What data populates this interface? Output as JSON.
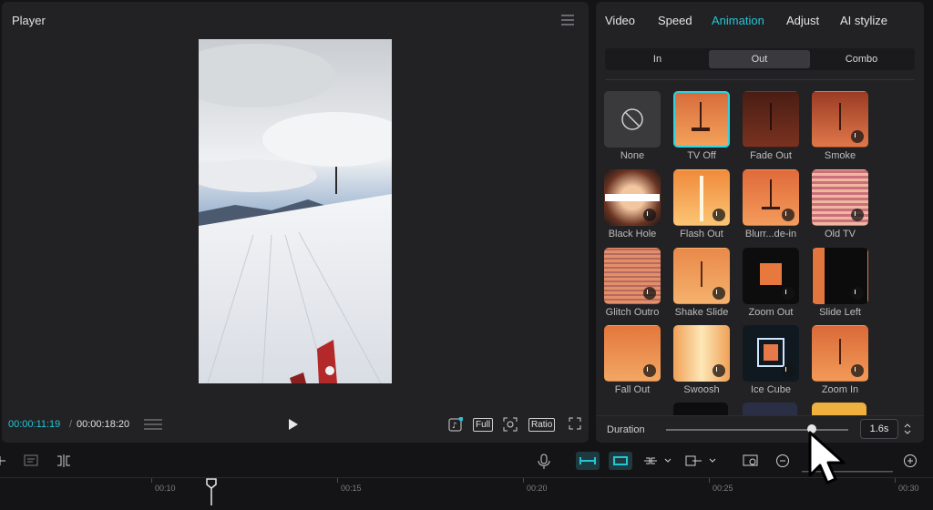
{
  "player": {
    "title": "Player",
    "current_time": "00:00:11:19",
    "separator": "/",
    "total_time": "00:00:18:20",
    "controls": {
      "full": "Full",
      "ratio": "Ratio"
    }
  },
  "right_panel": {
    "tabs": [
      "Video",
      "Speed",
      "Animation",
      "Adjust",
      "AI stylize"
    ],
    "active_tab": "Animation",
    "segments": [
      "In",
      "Out",
      "Combo"
    ],
    "active_segment": "Out",
    "items": [
      {
        "label": "None"
      },
      {
        "label": "TV Off"
      },
      {
        "label": "Fade Out"
      },
      {
        "label": "Smoke"
      },
      {
        "label": "Black Hole"
      },
      {
        "label": "Flash Out"
      },
      {
        "label": "Blurr...de-in"
      },
      {
        "label": "Old TV"
      },
      {
        "label": "Glitch Outro"
      },
      {
        "label": "Shake Slide"
      },
      {
        "label": "Zoom Out"
      },
      {
        "label": "Slide Left"
      },
      {
        "label": "Fall Out"
      },
      {
        "label": "Swoosh"
      },
      {
        "label": "Ice Cube"
      },
      {
        "label": "Zoom In"
      }
    ],
    "duration": {
      "label": "Duration",
      "value": "1.6s",
      "slider_fraction": 0.8
    }
  },
  "timeline": {
    "ruler_labels": [
      "00:10",
      "00:15",
      "00:20",
      "00:25",
      "00:30"
    ]
  },
  "colors": {
    "accent": "#23c6d6"
  }
}
